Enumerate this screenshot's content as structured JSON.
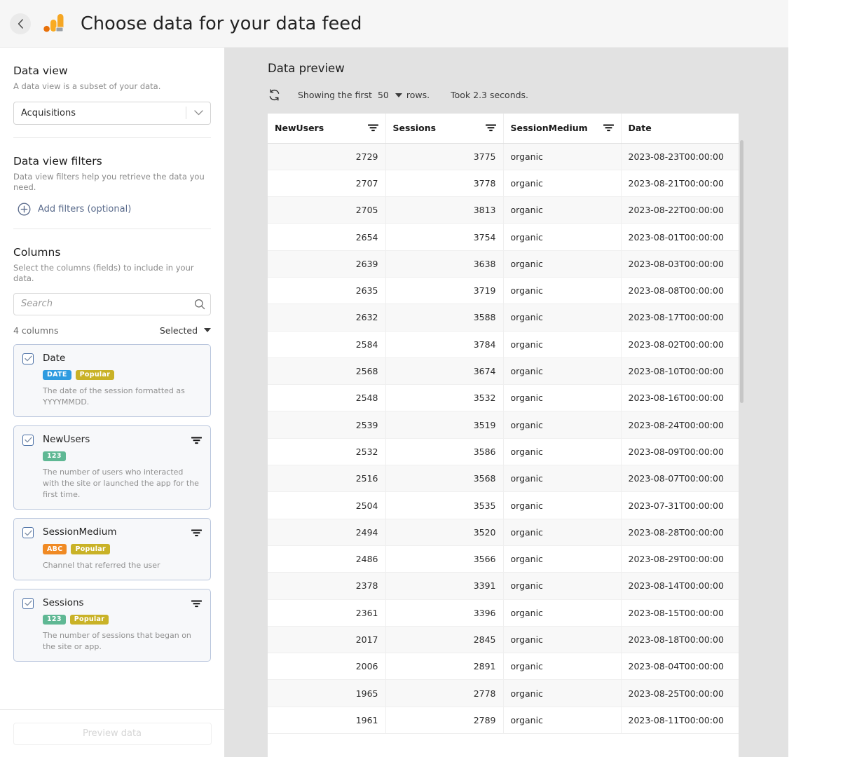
{
  "header": {
    "title": "Choose data for your data feed",
    "back_label": "Back",
    "app_icon": "google-analytics-icon"
  },
  "sidebar": {
    "data_view": {
      "title": "Data view",
      "subtitle": "A data view is a subset of your data.",
      "selected": "Acquisitions"
    },
    "data_view_filters": {
      "title": "Data view filters",
      "subtitle": "Data view filters help you retrieve the data you need.",
      "add_filters_label": "Add filters (optional)"
    },
    "columns": {
      "title": "Columns",
      "subtitle": "Select the columns (fields) to include in your data.",
      "search_placeholder": "Search",
      "search_value": "",
      "count_label": "4 columns",
      "sort_label": "Selected",
      "items": [
        {
          "name": "Date",
          "checked": true,
          "has_filter": false,
          "badges": [
            {
              "label": "DATE",
              "color": "#2E9BE0"
            },
            {
              "label": "Popular",
              "color": "#C9B227"
            }
          ],
          "description": "The date of the session formatted as YYYYMMDD."
        },
        {
          "name": "NewUsers",
          "checked": true,
          "has_filter": true,
          "badges": [
            {
              "label": "123",
              "color": "#5FB894"
            }
          ],
          "description": "The number of users who interacted with the site or launched the app for the first time."
        },
        {
          "name": "SessionMedium",
          "checked": true,
          "has_filter": true,
          "badges": [
            {
              "label": "ABC",
              "color": "#F08A24"
            },
            {
              "label": "Popular",
              "color": "#C9B227"
            }
          ],
          "description": "Channel that referred the user"
        },
        {
          "name": "Sessions",
          "checked": true,
          "has_filter": true,
          "badges": [
            {
              "label": "123",
              "color": "#5FB894"
            },
            {
              "label": "Popular",
              "color": "#C9B227"
            }
          ],
          "description": "The number of sessions that began on the site or app."
        }
      ]
    },
    "footer": {
      "preview_button": "Preview data",
      "preview_enabled": false
    }
  },
  "main": {
    "title": "Data preview",
    "refresh_icon": "refresh-icon",
    "showing_prefix": "Showing the first",
    "row_limit": "50",
    "showing_suffix": "rows.",
    "timing": "Took 2.3 seconds.",
    "table": {
      "columns": [
        {
          "label": "NewUsers",
          "align": "num",
          "has_filter": true
        },
        {
          "label": "Sessions",
          "align": "num",
          "has_filter": true
        },
        {
          "label": "SessionMedium",
          "align": "text",
          "has_filter": true
        },
        {
          "label": "Date",
          "align": "text",
          "has_filter": false
        }
      ],
      "rows": [
        [
          "2729",
          "3775",
          "organic",
          "2023-08-23T00:00:00"
        ],
        [
          "2707",
          "3778",
          "organic",
          "2023-08-21T00:00:00"
        ],
        [
          "2705",
          "3813",
          "organic",
          "2023-08-22T00:00:00"
        ],
        [
          "2654",
          "3754",
          "organic",
          "2023-08-01T00:00:00"
        ],
        [
          "2639",
          "3638",
          "organic",
          "2023-08-03T00:00:00"
        ],
        [
          "2635",
          "3719",
          "organic",
          "2023-08-08T00:00:00"
        ],
        [
          "2632",
          "3588",
          "organic",
          "2023-08-17T00:00:00"
        ],
        [
          "2584",
          "3784",
          "organic",
          "2023-08-02T00:00:00"
        ],
        [
          "2568",
          "3674",
          "organic",
          "2023-08-10T00:00:00"
        ],
        [
          "2548",
          "3532",
          "organic",
          "2023-08-16T00:00:00"
        ],
        [
          "2539",
          "3519",
          "organic",
          "2023-08-24T00:00:00"
        ],
        [
          "2532",
          "3586",
          "organic",
          "2023-08-09T00:00:00"
        ],
        [
          "2516",
          "3568",
          "organic",
          "2023-08-07T00:00:00"
        ],
        [
          "2504",
          "3535",
          "organic",
          "2023-07-31T00:00:00"
        ],
        [
          "2494",
          "3520",
          "organic",
          "2023-08-28T00:00:00"
        ],
        [
          "2486",
          "3566",
          "organic",
          "2023-08-29T00:00:00"
        ],
        [
          "2378",
          "3391",
          "organic",
          "2023-08-14T00:00:00"
        ],
        [
          "2361",
          "3396",
          "organic",
          "2023-08-15T00:00:00"
        ],
        [
          "2017",
          "2845",
          "organic",
          "2023-08-18T00:00:00"
        ],
        [
          "2006",
          "2891",
          "organic",
          "2023-08-04T00:00:00"
        ],
        [
          "1965",
          "2778",
          "organic",
          "2023-08-25T00:00:00"
        ],
        [
          "1961",
          "2789",
          "organic",
          "2023-08-11T00:00:00"
        ]
      ]
    }
  }
}
